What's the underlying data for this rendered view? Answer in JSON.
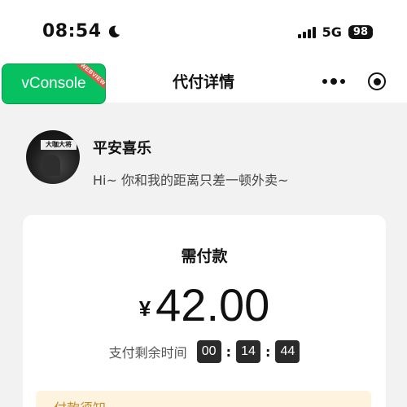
{
  "status_bar": {
    "time": "08:54",
    "network": "5G",
    "battery": "98"
  },
  "nav": {
    "title": "代付详情",
    "vconsole_label": "vConsole",
    "vconsole_tag": "WEBVIEW"
  },
  "profile": {
    "avatar_sign": "大咖大将",
    "name": "平安喜乐",
    "bio": "Hi~ 你和我的距离只差一顿外卖~"
  },
  "payment": {
    "label": "需付款",
    "currency": "¥",
    "amount": "42.00",
    "countdown_label": "支付剩余时间",
    "countdown": {
      "hours": "00",
      "minutes": "14",
      "seconds": "44"
    },
    "separator": ":"
  },
  "notice": {
    "title": "付款须知"
  }
}
